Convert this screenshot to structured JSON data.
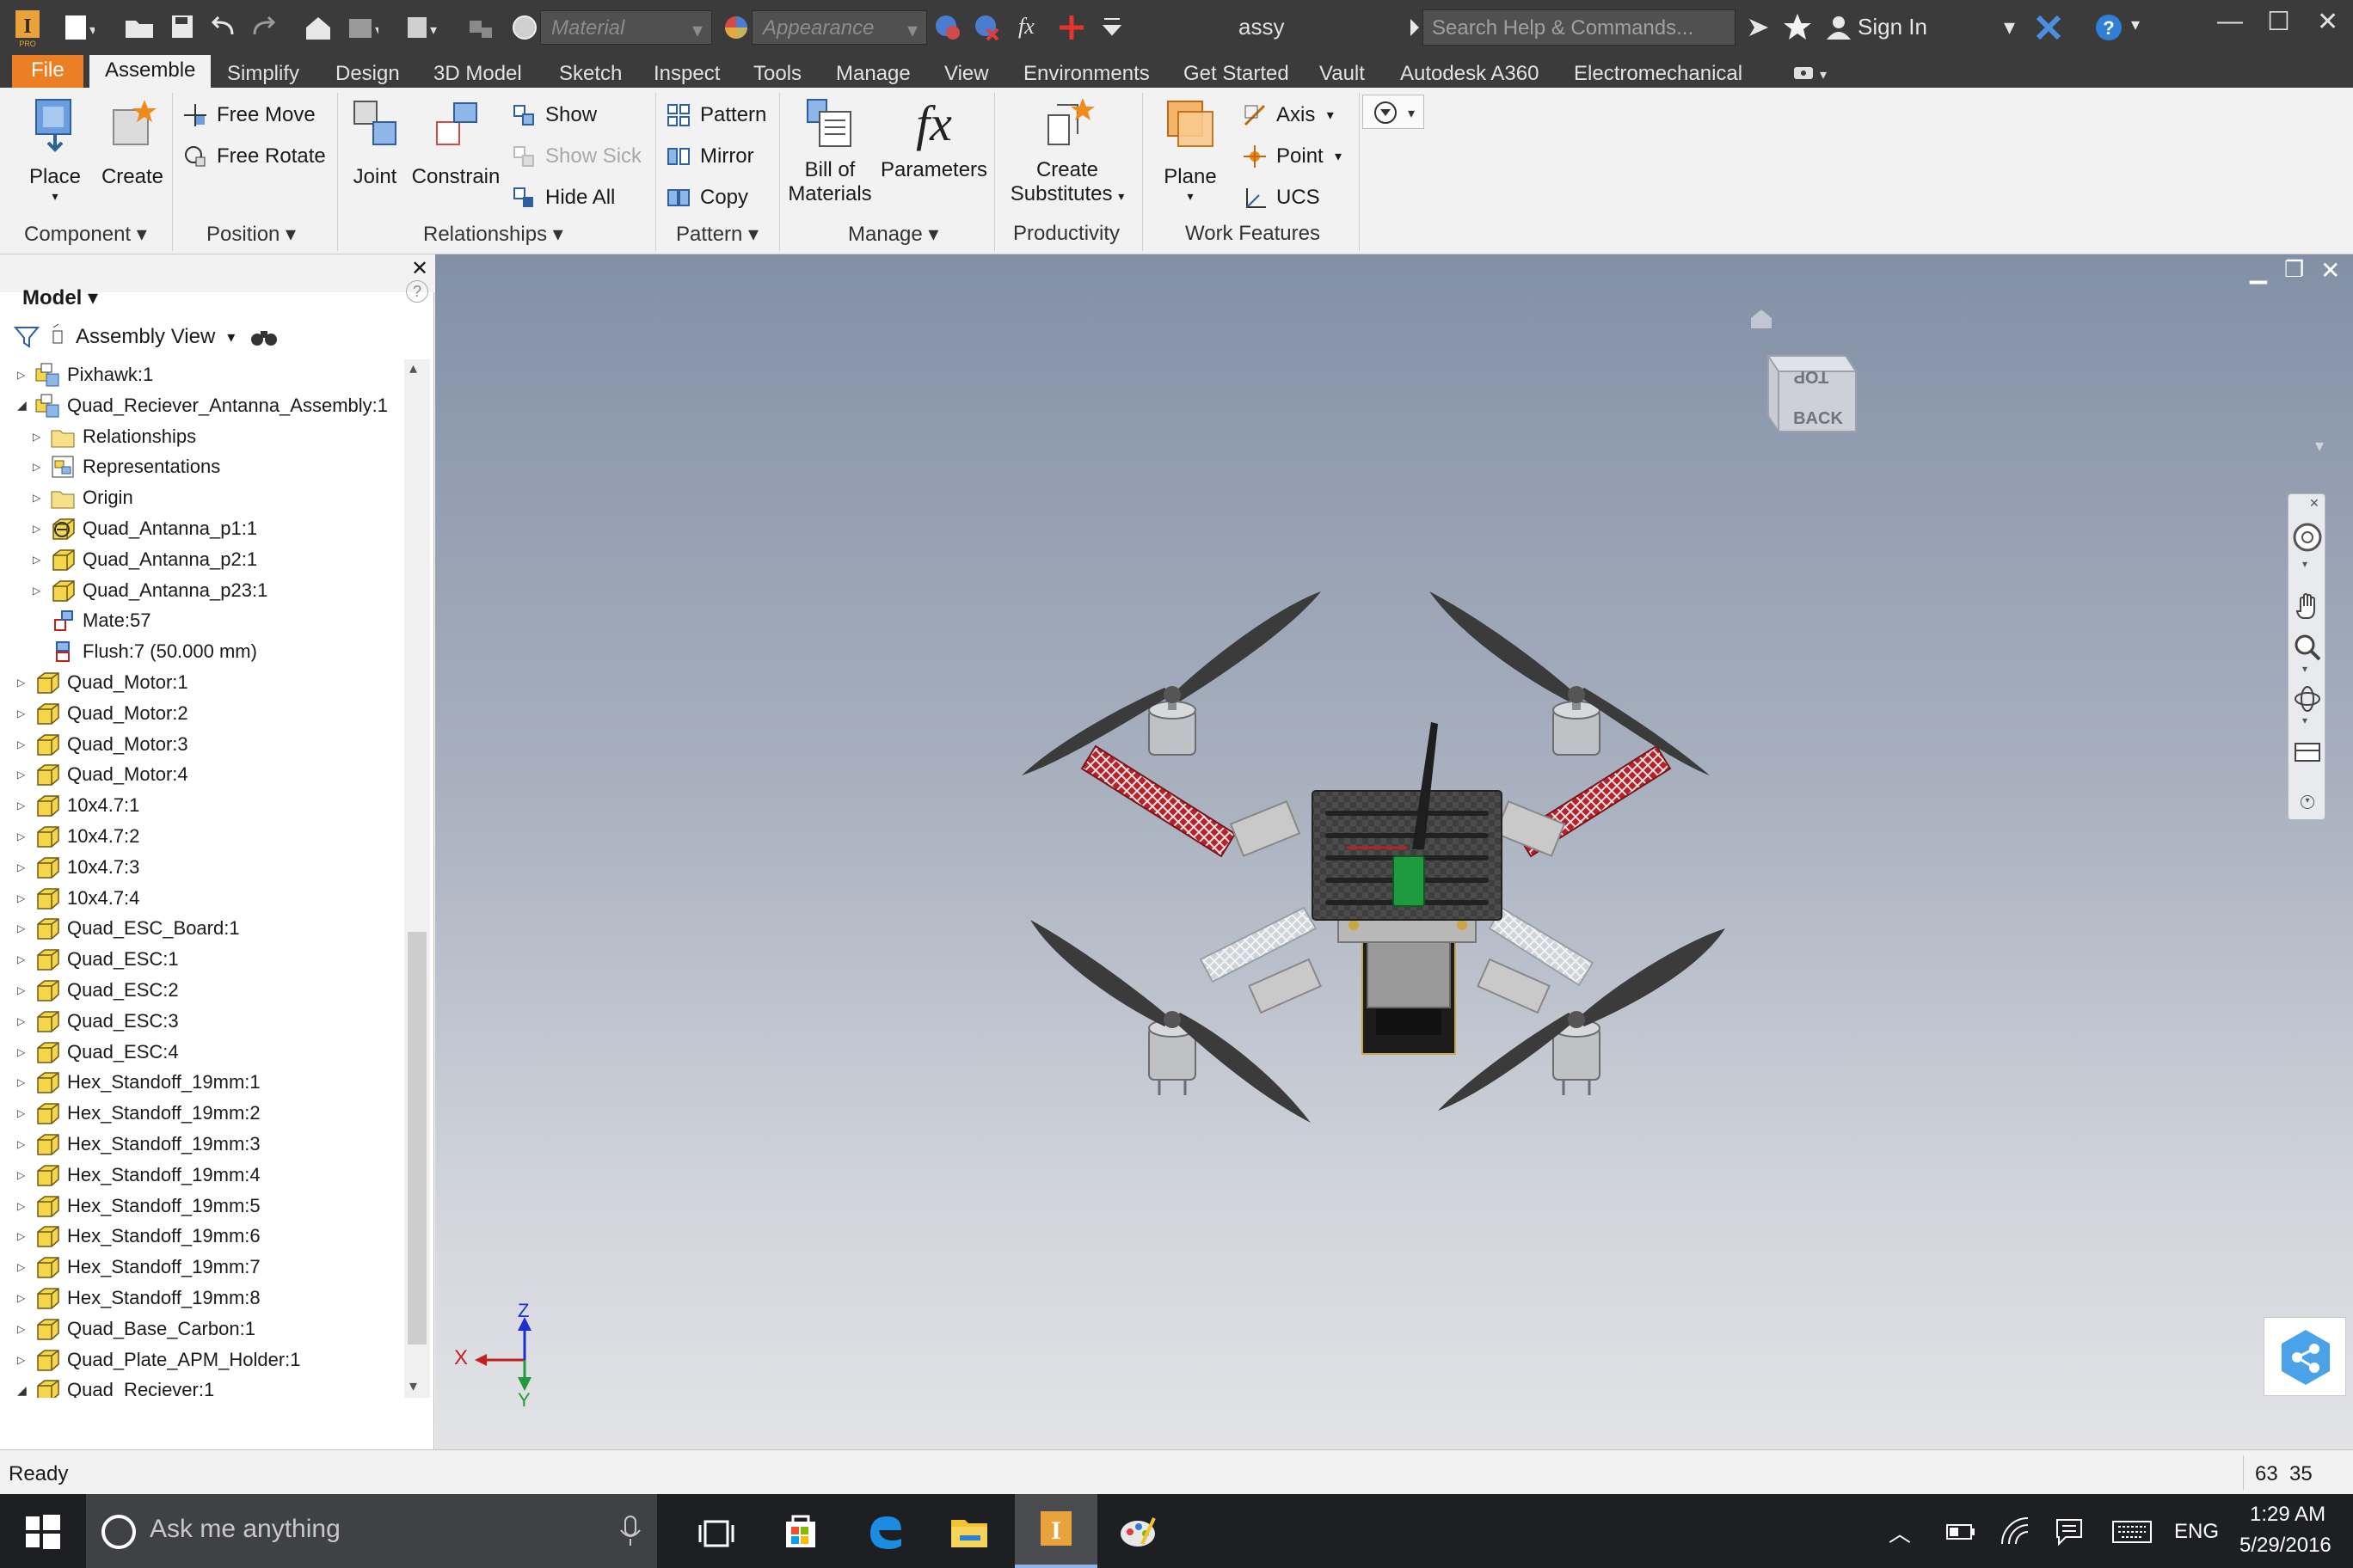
{
  "title": {
    "doc_name": "assy",
    "material_placeholder": "Material",
    "appearance_placeholder": "Appearance",
    "search_placeholder": "Search Help & Commands...",
    "sign_in": "Sign In",
    "fx": "fx"
  },
  "tabs": [
    "File",
    "Assemble",
    "Simplify",
    "Design",
    "3D Model",
    "Sketch",
    "Inspect",
    "Tools",
    "Manage",
    "View",
    "Environments",
    "Get Started",
    "Vault",
    "Autodesk A360",
    "Electromechanical"
  ],
  "ribbon": {
    "place": "Place",
    "create": "Create",
    "free_move": "Free Move",
    "free_rotate": "Free Rotate",
    "joint": "Joint",
    "constrain": "Constrain",
    "show": "Show",
    "show_sick": "Show Sick",
    "hide_all": "Hide All",
    "pattern": "Pattern",
    "mirror": "Mirror",
    "copy": "Copy",
    "bom_line1": "Bill of",
    "bom_line2": "Materials",
    "parameters": "Parameters",
    "fx_icon": "fx",
    "substitutes_line1": "Create",
    "substitutes_line2": "Substitutes",
    "plane": "Plane",
    "axis": "Axis",
    "point": "Point",
    "ucs": "UCS",
    "panels": {
      "component": "Component",
      "position": "Position",
      "relationships": "Relationships",
      "pattern": "Pattern",
      "manage": "Manage",
      "productivity": "Productivity",
      "work_features": "Work Features"
    }
  },
  "browser": {
    "title": "Model",
    "view": "Assembly View",
    "tree": [
      {
        "label": "Pixhawk:1",
        "level": 0,
        "expander": "collapsed",
        "icon": "assembly"
      },
      {
        "label": "Quad_Reciever_Antanna_Assembly:1",
        "level": 0,
        "expander": "expanded",
        "icon": "assembly"
      },
      {
        "label": "Relationships",
        "level": 1,
        "expander": "collapsed",
        "icon": "folder"
      },
      {
        "label": "Representations",
        "level": 1,
        "expander": "collapsed",
        "icon": "representations"
      },
      {
        "label": "Origin",
        "level": 1,
        "expander": "collapsed",
        "icon": "folder"
      },
      {
        "label": "Quad_Antanna_p1:1",
        "level": 1,
        "expander": "collapsed",
        "icon": "part-grounded"
      },
      {
        "label": "Quad_Antanna_p2:1",
        "level": 1,
        "expander": "collapsed",
        "icon": "part"
      },
      {
        "label": "Quad_Antanna_p23:1",
        "level": 1,
        "expander": "collapsed",
        "icon": "part"
      },
      {
        "label": "Mate:57",
        "level": 1,
        "expander": "none",
        "icon": "mate"
      },
      {
        "label": "Flush:7 (50.000 mm)",
        "level": 1,
        "expander": "none",
        "icon": "flush"
      },
      {
        "label": "Quad_Motor:1",
        "level": 0,
        "expander": "collapsed",
        "icon": "part"
      },
      {
        "label": "Quad_Motor:2",
        "level": 0,
        "expander": "collapsed",
        "icon": "part"
      },
      {
        "label": "Quad_Motor:3",
        "level": 0,
        "expander": "collapsed",
        "icon": "part"
      },
      {
        "label": "Quad_Motor:4",
        "level": 0,
        "expander": "collapsed",
        "icon": "part"
      },
      {
        "label": "10x4.7:1",
        "level": 0,
        "expander": "collapsed",
        "icon": "part"
      },
      {
        "label": "10x4.7:2",
        "level": 0,
        "expander": "collapsed",
        "icon": "part"
      },
      {
        "label": "10x4.7:3",
        "level": 0,
        "expander": "collapsed",
        "icon": "part"
      },
      {
        "label": "10x4.7:4",
        "level": 0,
        "expander": "collapsed",
        "icon": "part"
      },
      {
        "label": "Quad_ESC_Board:1",
        "level": 0,
        "expander": "collapsed",
        "icon": "part"
      },
      {
        "label": "Quad_ESC:1",
        "level": 0,
        "expander": "collapsed",
        "icon": "part"
      },
      {
        "label": "Quad_ESC:2",
        "level": 0,
        "expander": "collapsed",
        "icon": "part"
      },
      {
        "label": "Quad_ESC:3",
        "level": 0,
        "expander": "collapsed",
        "icon": "part"
      },
      {
        "label": "Quad_ESC:4",
        "level": 0,
        "expander": "collapsed",
        "icon": "part"
      },
      {
        "label": "Hex_Standoff_19mm:1",
        "level": 0,
        "expander": "collapsed",
        "icon": "part"
      },
      {
        "label": "Hex_Standoff_19mm:2",
        "level": 0,
        "expander": "collapsed",
        "icon": "part"
      },
      {
        "label": "Hex_Standoff_19mm:3",
        "level": 0,
        "expander": "collapsed",
        "icon": "part"
      },
      {
        "label": "Hex_Standoff_19mm:4",
        "level": 0,
        "expander": "collapsed",
        "icon": "part"
      },
      {
        "label": "Hex_Standoff_19mm:5",
        "level": 0,
        "expander": "collapsed",
        "icon": "part"
      },
      {
        "label": "Hex_Standoff_19mm:6",
        "level": 0,
        "expander": "collapsed",
        "icon": "part"
      },
      {
        "label": "Hex_Standoff_19mm:7",
        "level": 0,
        "expander": "collapsed",
        "icon": "part"
      },
      {
        "label": "Hex_Standoff_19mm:8",
        "level": 0,
        "expander": "collapsed",
        "icon": "part"
      },
      {
        "label": "Quad_Base_Carbon:1",
        "level": 0,
        "expander": "collapsed",
        "icon": "part"
      },
      {
        "label": "Quad_Plate_APM_Holder:1",
        "level": 0,
        "expander": "collapsed",
        "icon": "part"
      },
      {
        "label": "Quad_Reciever:1",
        "level": 0,
        "expander": "expanded",
        "icon": "part"
      }
    ]
  },
  "viewport": {
    "viewcube_top": "TOP",
    "viewcube_back": "BACK",
    "triad_x": "X",
    "triad_y": "Y",
    "triad_z": "Z"
  },
  "status": {
    "text": "Ready",
    "count_a": "63",
    "count_b": "35"
  },
  "taskbar": {
    "search": "Ask me anything",
    "lang": "ENG",
    "time": "1:29 AM",
    "date": "5/29/2016"
  },
  "colors": {
    "accent": "#ec7e23",
    "titlebar": "#3b3b3b",
    "ribbon": "#f2f2f2",
    "frame_red": "#b8212a",
    "antenna_green": "#1f9b3f"
  }
}
